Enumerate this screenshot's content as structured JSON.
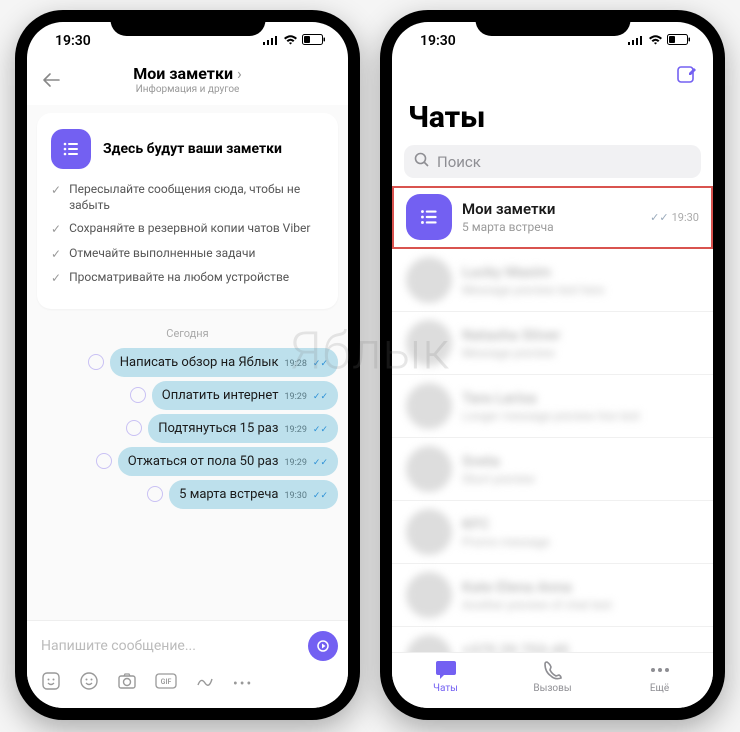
{
  "status": {
    "time": "19:30"
  },
  "left": {
    "nav": {
      "title": "Мои заметки",
      "subtitle": "Информация и другое"
    },
    "intro": {
      "title": "Здесь будут ваши заметки",
      "lines": [
        "Пересылайте сообщения сюда, чтобы не забыть",
        "Сохраняйте в резервной копии чатов Viber",
        "Отмечайте выполненные задачи",
        "Просматривайте на любом устройстве"
      ]
    },
    "day_label": "Сегодня",
    "messages": [
      {
        "text": "Написать обзор на Яблык",
        "time": "19:28"
      },
      {
        "text": "Оплатить интернет",
        "time": "19:29"
      },
      {
        "text": "Подтянуться 15 раз",
        "time": "19:29"
      },
      {
        "text": "Отжаться от пола 50 раз",
        "time": "19:29"
      },
      {
        "text": "5 марта встреча",
        "time": "19:30"
      }
    ],
    "composer_placeholder": "Напишите сообщение..."
  },
  "right": {
    "title": "Чаты",
    "search_placeholder": "Поиск",
    "notes_item": {
      "name": "Мои заметки",
      "preview": "5 марта встреча",
      "time": "19:30"
    },
    "tabs": {
      "chats": "Чаты",
      "calls": "Вызовы",
      "more": "Ещё"
    }
  },
  "watermark": "Яблык"
}
